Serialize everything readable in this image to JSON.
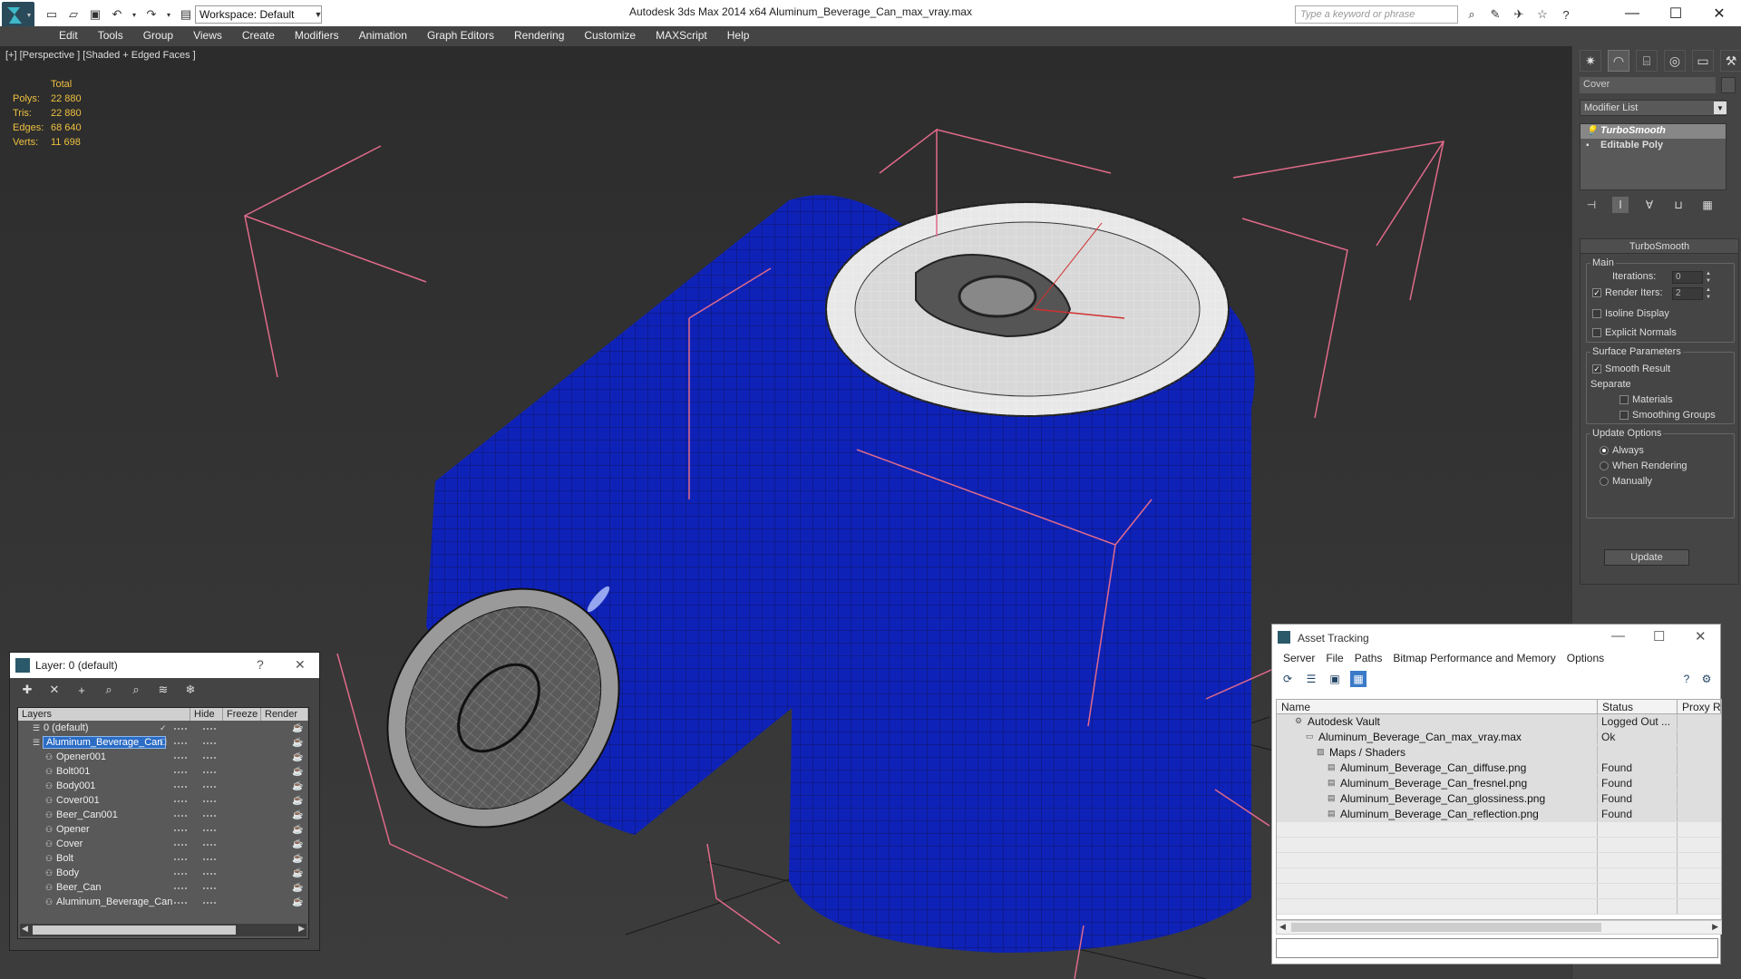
{
  "titlebar": {
    "workspace": "Workspace: Default",
    "app_title": "Autodesk 3ds Max  2014 x64      Aluminum_Beverage_Can_max_vray.max",
    "search_placeholder": "Type a keyword or phrase"
  },
  "menu": [
    "Edit",
    "Tools",
    "Group",
    "Views",
    "Create",
    "Modifiers",
    "Animation",
    "Graph Editors",
    "Rendering",
    "Customize",
    "MAXScript",
    "Help"
  ],
  "viewport": {
    "label": "[+] [Perspective ] [Shaded + Edged Faces ]",
    "stats": {
      "header": "Total",
      "rows": [
        {
          "label": "Polys:",
          "value": "22 880"
        },
        {
          "label": "Tris:",
          "value": "22 880"
        },
        {
          "label": "Edges:",
          "value": "68 640"
        },
        {
          "label": "Verts:",
          "value": "11 698"
        }
      ]
    },
    "can_color": "#0f22b8"
  },
  "command_panel": {
    "object_name": "Cover",
    "modifier_list": "Modifier List",
    "stack": [
      "TurboSmooth",
      "Editable Poly"
    ],
    "rollout": {
      "title": "TurboSmooth",
      "main_label": "Main",
      "iterations_label": "Iterations:",
      "iterations_value": "0",
      "render_iters_label": "Render Iters:",
      "render_iters_value": "2",
      "isoline_label": "Isoline Display",
      "explicit_label": "Explicit Normals",
      "surface_label": "Surface Parameters",
      "smooth_label": "Smooth Result",
      "separate_label": "Separate",
      "materials_label": "Materials",
      "smoothing_groups_label": "Smoothing Groups",
      "update_options_label": "Update Options",
      "always_label": "Always",
      "when_rendering_label": "When Rendering",
      "manually_label": "Manually",
      "update_button": "Update"
    }
  },
  "layer_dialog": {
    "title": "Layer: 0 (default)",
    "columns": [
      "Layers",
      "Hide",
      "Freeze",
      "Render"
    ],
    "rows": [
      {
        "name": "0 (default)",
        "indent": 0,
        "type": "layer"
      },
      {
        "name": "Aluminum_Beverage_Can",
        "indent": 0,
        "type": "layer"
      },
      {
        "name": "Opener001",
        "indent": 1,
        "type": "object"
      },
      {
        "name": "Bolt001",
        "indent": 1,
        "type": "object"
      },
      {
        "name": "Body001",
        "indent": 1,
        "type": "object"
      },
      {
        "name": "Cover001",
        "indent": 1,
        "type": "object"
      },
      {
        "name": "Beer_Can001",
        "indent": 1,
        "type": "object"
      },
      {
        "name": "Opener",
        "indent": 1,
        "type": "object"
      },
      {
        "name": "Cover",
        "indent": 1,
        "type": "object"
      },
      {
        "name": "Bolt",
        "indent": 1,
        "type": "object"
      },
      {
        "name": "Body",
        "indent": 1,
        "type": "object"
      },
      {
        "name": "Beer_Can",
        "indent": 1,
        "type": "object"
      },
      {
        "name": "Aluminum_Beverage_Can",
        "indent": 1,
        "type": "object"
      }
    ]
  },
  "asset_dialog": {
    "title": "Asset Tracking",
    "menu": [
      "Server",
      "File",
      "Paths",
      "Bitmap Performance and Memory",
      "Options"
    ],
    "columns": [
      "Name",
      "Status",
      "Proxy Re"
    ],
    "rows": [
      {
        "name": "Autodesk Vault",
        "status": "Logged Out ...",
        "indent": 1,
        "icon": "vault"
      },
      {
        "name": "Aluminum_Beverage_Can_max_vray.max",
        "status": "Ok",
        "indent": 2,
        "icon": "max"
      },
      {
        "name": "Maps / Shaders",
        "status": "",
        "indent": 3,
        "icon": "maps"
      },
      {
        "name": "Aluminum_Beverage_Can_diffuse.png",
        "status": "Found",
        "indent": 4,
        "icon": "png"
      },
      {
        "name": "Aluminum_Beverage_Can_fresnel.png",
        "status": "Found",
        "indent": 4,
        "icon": "png"
      },
      {
        "name": "Aluminum_Beverage_Can_glossiness.png",
        "status": "Found",
        "indent": 4,
        "icon": "png"
      },
      {
        "name": "Aluminum_Beverage_Can_reflection.png",
        "status": "Found",
        "indent": 4,
        "icon": "png"
      }
    ]
  }
}
